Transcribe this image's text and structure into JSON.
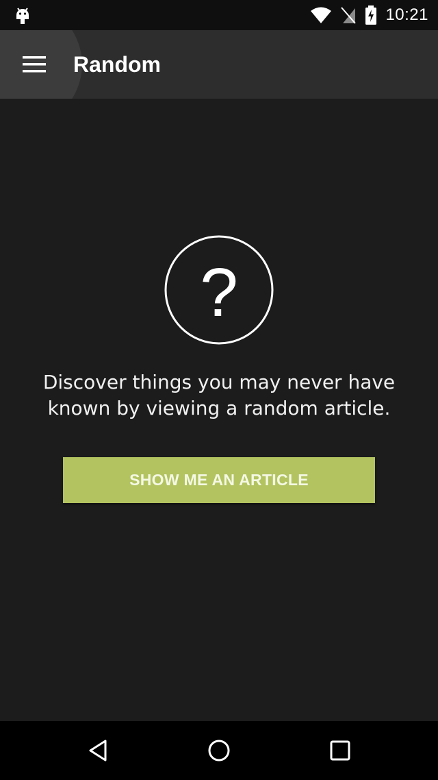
{
  "status_bar": {
    "time": "10:21",
    "icons": [
      "android-icon",
      "wifi-icon",
      "no-sim-icon",
      "battery-charging-icon"
    ]
  },
  "app_bar": {
    "menu_icon": "hamburger-menu-icon",
    "title": "Random"
  },
  "main": {
    "icon": "question-mark-circle-icon",
    "question_glyph": "?",
    "message": "Discover things you may never have known by viewing a random article.",
    "button_label": "SHOW ME AN ARTICLE"
  },
  "nav_bar": {
    "icons": [
      "back-icon",
      "home-icon",
      "recents-icon"
    ]
  },
  "colors": {
    "background": "#1c1c1c",
    "app_bar": "#2d2d2d",
    "accent": "#b2c360",
    "status_bar": "#0f0f0f",
    "nav_bar": "#000000"
  }
}
